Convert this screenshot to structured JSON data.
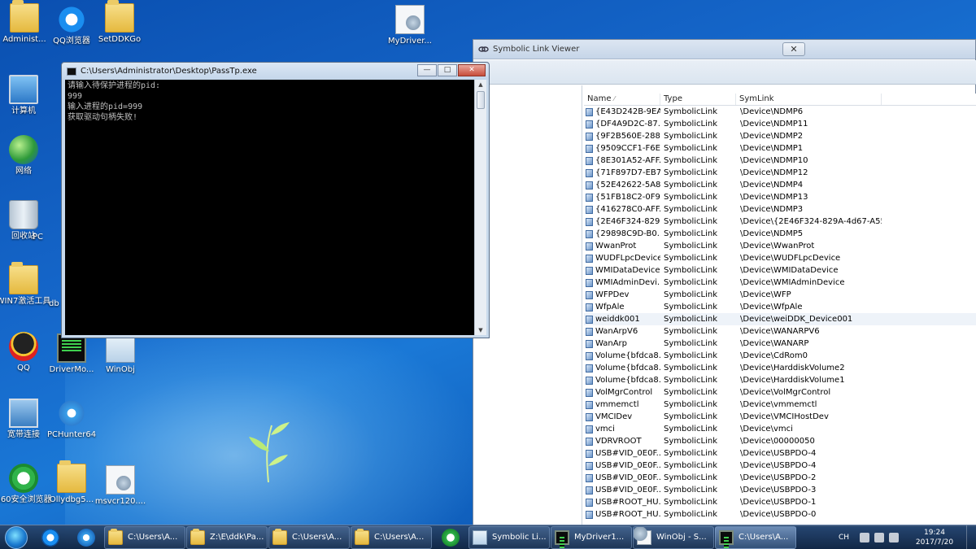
{
  "desktop": {
    "icons": [
      {
        "label": "Administ...",
        "icon": "folder-icon"
      },
      {
        "label": "QQ浏览器",
        "icon": "qq-browser-icon"
      },
      {
        "label": "SetDDKGo",
        "icon": "folder-icon"
      },
      {
        "label": "MyDriver...",
        "icon": "file-icon"
      },
      {
        "label": "计算机",
        "icon": "computer-icon"
      },
      {
        "label": "网络",
        "icon": "network-globe-icon"
      },
      {
        "label": "回收站",
        "icon": "recycle-bin-icon"
      },
      {
        "label": "PC",
        "icon": "file-icon"
      },
      {
        "label": "WIN7激活工具",
        "icon": "folder-icon"
      },
      {
        "label": "db",
        "icon": "file-icon"
      },
      {
        "label": "QQ",
        "icon": "qq-icon"
      },
      {
        "label": "DriverMo...",
        "icon": "terminal-icon"
      },
      {
        "label": "WinObj",
        "icon": "file-icon"
      },
      {
        "label": "宽带连接",
        "icon": "network-connection-icon"
      },
      {
        "label": "PCHunter64",
        "icon": "pchunter-icon"
      },
      {
        "label": "360安全浏览器",
        "icon": "browser-360-icon"
      },
      {
        "label": "Ollydbg5...",
        "icon": "folder-icon"
      },
      {
        "label": "msvcr120....",
        "icon": "file-icon"
      }
    ]
  },
  "symlink_viewer": {
    "title": "Symbolic Link Viewer",
    "close_label": "✕",
    "columns": {
      "name": "Name",
      "type": "Type",
      "symlink": "SymLink",
      "sort_indicator": "⁄"
    },
    "rows": [
      {
        "name": "{E43D242B-9EA...",
        "type": "SymbolicLink",
        "symlink": "\\Device\\NDMP6"
      },
      {
        "name": "{DF4A9D2C-87...",
        "type": "SymbolicLink",
        "symlink": "\\Device\\NDMP11"
      },
      {
        "name": "{9F2B560E-288...",
        "type": "SymbolicLink",
        "symlink": "\\Device\\NDMP2"
      },
      {
        "name": "{9509CCF1-F6E...",
        "type": "SymbolicLink",
        "symlink": "\\Device\\NDMP1"
      },
      {
        "name": "{8E301A52-AFF...",
        "type": "SymbolicLink",
        "symlink": "\\Device\\NDMP10"
      },
      {
        "name": "{71F897D7-EB7...",
        "type": "SymbolicLink",
        "symlink": "\\Device\\NDMP12"
      },
      {
        "name": "{52E42622-5A8...",
        "type": "SymbolicLink",
        "symlink": "\\Device\\NDMP4"
      },
      {
        "name": "{51FB18C2-0F9...",
        "type": "SymbolicLink",
        "symlink": "\\Device\\NDMP13"
      },
      {
        "name": "{416278C0-AFF...",
        "type": "SymbolicLink",
        "symlink": "\\Device\\NDMP3"
      },
      {
        "name": "{2E46F324-829...",
        "type": "SymbolicLink",
        "symlink": "\\Device\\{2E46F324-829A-4d67-A55..."
      },
      {
        "name": "{29898C9D-B0...",
        "type": "SymbolicLink",
        "symlink": "\\Device\\NDMP5"
      },
      {
        "name": "WwanProt",
        "type": "SymbolicLink",
        "symlink": "\\Device\\WwanProt"
      },
      {
        "name": "WUDFLpcDevice",
        "type": "SymbolicLink",
        "symlink": "\\Device\\WUDFLpcDevice"
      },
      {
        "name": "WMIDataDevice",
        "type": "SymbolicLink",
        "symlink": "\\Device\\WMIDataDevice"
      },
      {
        "name": "WMIAdminDevi...",
        "type": "SymbolicLink",
        "symlink": "\\Device\\WMIAdminDevice"
      },
      {
        "name": "WFPDev",
        "type": "SymbolicLink",
        "symlink": "\\Device\\WFP"
      },
      {
        "name": "WfpAle",
        "type": "SymbolicLink",
        "symlink": "\\Device\\WfpAle"
      },
      {
        "name": "weiddk001",
        "type": "SymbolicLink",
        "symlink": "\\Device\\weiDDK_Device001"
      },
      {
        "name": "WanArpV6",
        "type": "SymbolicLink",
        "symlink": "\\Device\\WANARPV6"
      },
      {
        "name": "WanArp",
        "type": "SymbolicLink",
        "symlink": "\\Device\\WANARP"
      },
      {
        "name": "Volume{bfdca8...",
        "type": "SymbolicLink",
        "symlink": "\\Device\\CdRom0"
      },
      {
        "name": "Volume{bfdca8...",
        "type": "SymbolicLink",
        "symlink": "\\Device\\HarddiskVolume2"
      },
      {
        "name": "Volume{bfdca8...",
        "type": "SymbolicLink",
        "symlink": "\\Device\\HarddiskVolume1"
      },
      {
        "name": "VolMgrControl",
        "type": "SymbolicLink",
        "symlink": "\\Device\\VolMgrControl"
      },
      {
        "name": "vmmemctl",
        "type": "SymbolicLink",
        "symlink": "\\Device\\vmmemctl"
      },
      {
        "name": "VMCIDev",
        "type": "SymbolicLink",
        "symlink": "\\Device\\VMCIHostDev"
      },
      {
        "name": "vmci",
        "type": "SymbolicLink",
        "symlink": "\\Device\\vmci"
      },
      {
        "name": "VDRVROOT",
        "type": "SymbolicLink",
        "symlink": "\\Device\\00000050"
      },
      {
        "name": "USB#VID_0E0F...",
        "type": "SymbolicLink",
        "symlink": "\\Device\\USBPDO-4"
      },
      {
        "name": "USB#VID_0E0F...",
        "type": "SymbolicLink",
        "symlink": "\\Device\\USBPDO-4"
      },
      {
        "name": "USB#VID_0E0F...",
        "type": "SymbolicLink",
        "symlink": "\\Device\\USBPDO-2"
      },
      {
        "name": "USB#VID_0E0F...",
        "type": "SymbolicLink",
        "symlink": "\\Device\\USBPDO-3"
      },
      {
        "name": "USB#ROOT_HU...",
        "type": "SymbolicLink",
        "symlink": "\\Device\\USBPDO-1"
      },
      {
        "name": "USB#ROOT_HU...",
        "type": "SymbolicLink",
        "symlink": "\\Device\\USBPDO-0"
      }
    ],
    "selected_row": "weiddk001"
  },
  "console": {
    "title": "C:\\Users\\Administrator\\Desktop\\PassTp.exe",
    "buttons": {
      "minimize": "—",
      "maximize": "□",
      "close": "✕"
    },
    "lines": [
      "请输入待保护进程的pid:",
      "999",
      "输入进程的pid=999",
      "获取驱动句柄失败!"
    ]
  },
  "taskbar": {
    "buttons": [
      {
        "label": "C:\\Users\\A...",
        "icon": "folder-icon"
      },
      {
        "label": "Z:\\E\\ddk\\Pa...",
        "icon": "folder-icon"
      },
      {
        "label": "C:\\Users\\A...",
        "icon": "folder-icon"
      },
      {
        "label": "C:\\Users\\A...",
        "icon": "folder-icon"
      },
      {
        "label": "Symbolic Li...",
        "icon": "symlink-app-icon"
      },
      {
        "label": "MyDriver1...",
        "icon": "terminal-icon"
      },
      {
        "label": "WinObj - S...",
        "icon": "winobj-icon"
      },
      {
        "label": "C:\\Users\\A...",
        "icon": "cmd-icon"
      }
    ],
    "tray": {
      "lang": "CH",
      "time": "19:24",
      "date": "2017/7/20"
    }
  }
}
